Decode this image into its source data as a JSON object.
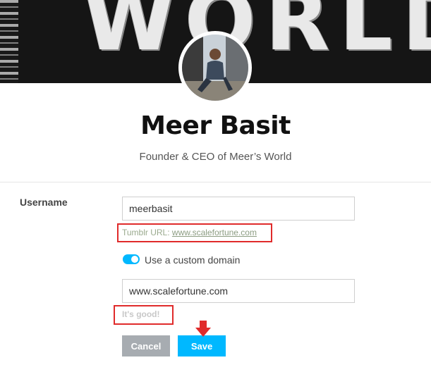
{
  "header": {
    "banner_text": "WORLD",
    "profile_name": "Meer Basit",
    "profile_description": "Founder & CEO of Meer’s World"
  },
  "form": {
    "username_label": "Username",
    "username_value": "meerbasit",
    "tumblr_url_label": "Tumblr URL:",
    "tumblr_url_link": "www.scalefortune.com",
    "custom_domain_label": "Use a custom domain",
    "custom_domain_enabled": true,
    "domain_value": "www.scalefortune.com",
    "domain_status": "It's good!",
    "cancel_label": "Cancel",
    "save_label": "Save"
  },
  "colors": {
    "accent": "#00b8ff",
    "annotation_red": "#e02b2b",
    "cancel_gray": "#a7acb1"
  }
}
